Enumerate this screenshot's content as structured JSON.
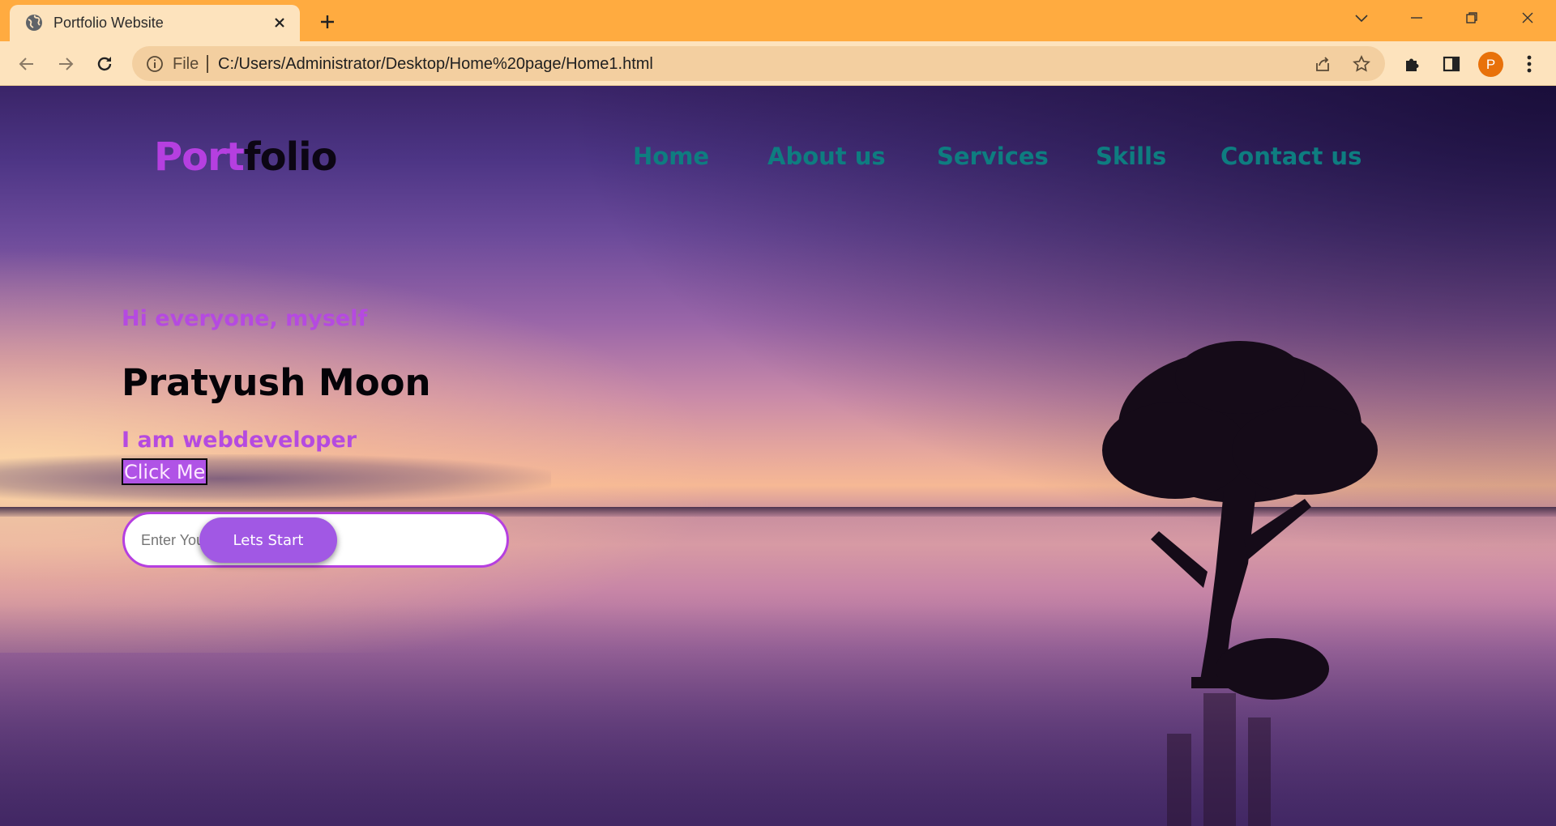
{
  "browser": {
    "tab_title": "Portfolio Website",
    "scheme_label": "File",
    "url": "C:/Users/Administrator/Desktop/Home%20page/Home1.html",
    "profile_initial": "P"
  },
  "page": {
    "logo": {
      "part1": "Port",
      "part2": "folio"
    },
    "nav": [
      "Home",
      "About us",
      "Services",
      "Skills",
      "Contact us"
    ],
    "greeting": "Hi everyone, myself",
    "name": "Pratyush Moon",
    "role": "I am webdeveloper",
    "click_button": "Click Me",
    "email_placeholder": "Enter Your Email",
    "start_button": "Lets Start"
  },
  "colors": {
    "accent": "#b53fe0",
    "nav": "#0e7d80",
    "button": "#a158e4",
    "tabbar": "#ffab40"
  }
}
